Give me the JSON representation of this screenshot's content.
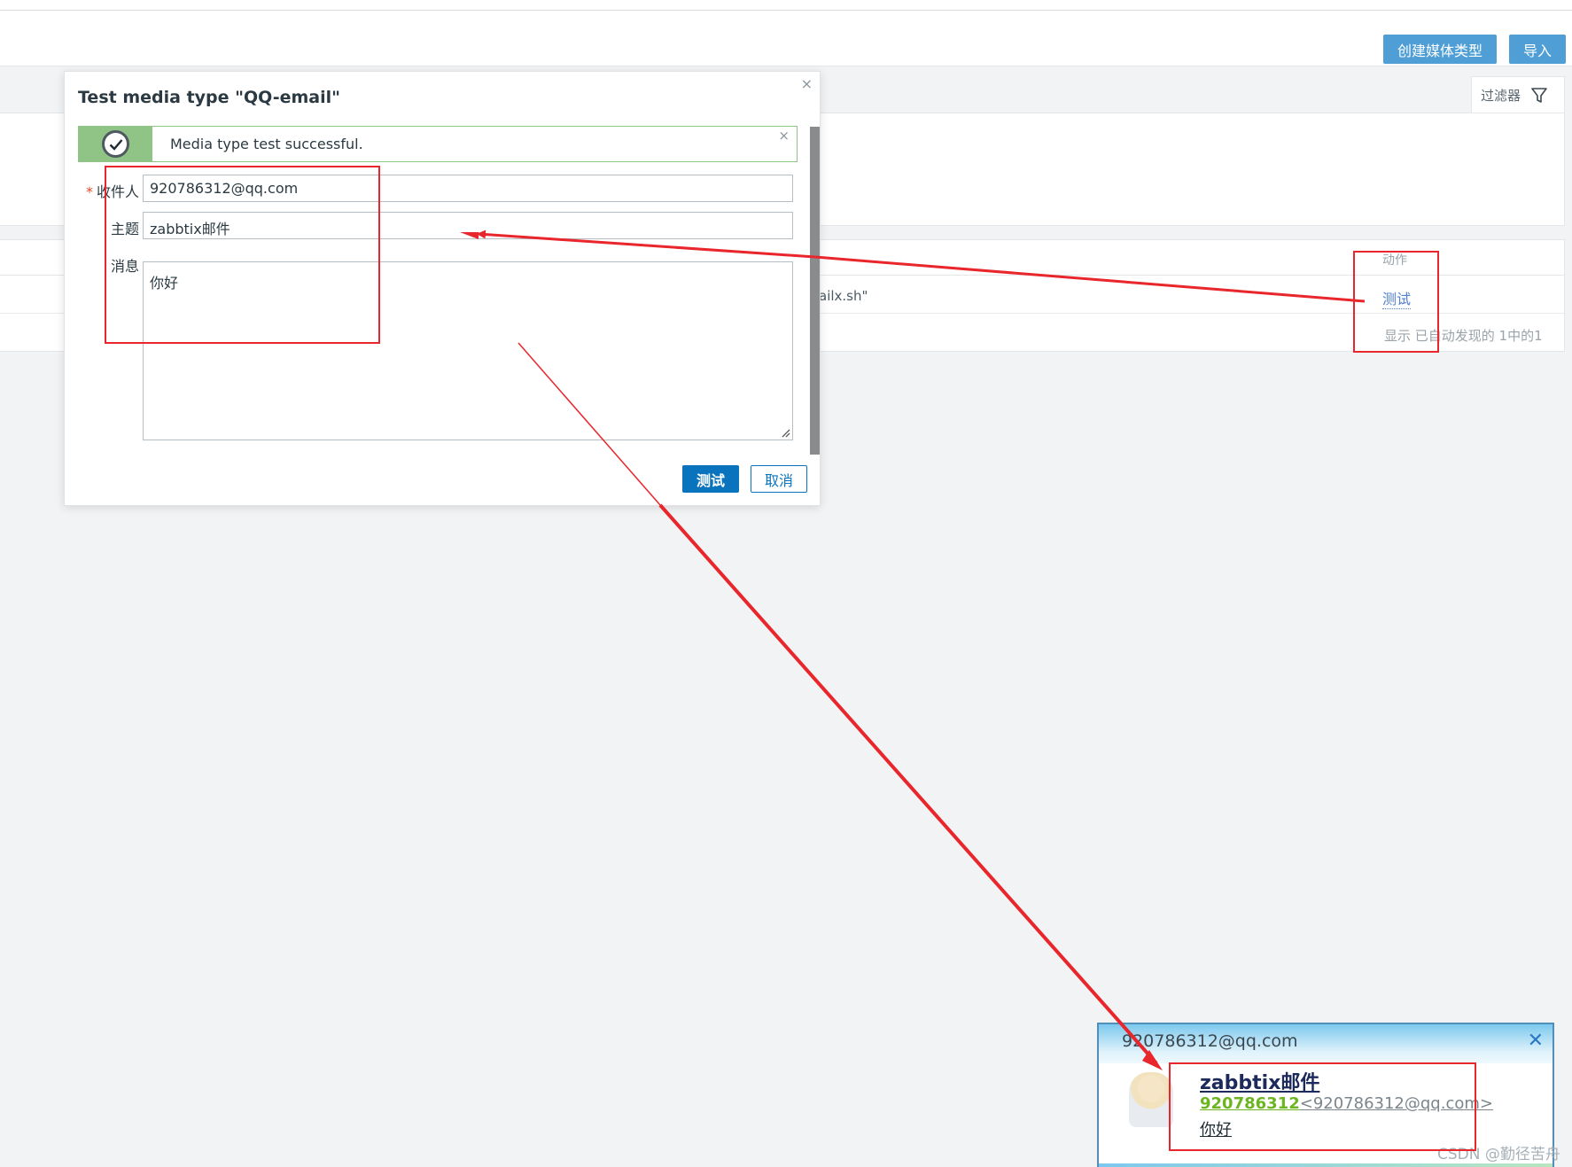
{
  "header": {
    "create_button": "创建媒体类型",
    "import_button": "导入"
  },
  "filter": {
    "label": "过滤器"
  },
  "table": {
    "action_header": "动作",
    "script_fragment": "ailx.sh\"",
    "test_link": "测试",
    "footer": "显示 已自动发现的 1中的1"
  },
  "modal": {
    "title": "Test media type \"QQ-email\"",
    "close": "×",
    "success_message": "Media type test successful.",
    "success_close": "×",
    "fields": {
      "recipient_label": "收件人",
      "recipient_required": "*",
      "recipient_value": "920786312@qq.com",
      "subject_label": "主题",
      "subject_value": "zabbtix邮件",
      "message_label": "消息",
      "message_value": "你好"
    },
    "test_button": "测试",
    "cancel_button": "取消"
  },
  "notification": {
    "from": "920786312@qq.com",
    "close": "✕",
    "subject": "zabbtix邮件",
    "sender_name": "920786312",
    "sender_address": "<920786312@qq.com>",
    "body": "你好"
  },
  "watermark": "CSDN @勤径苦舟",
  "icons": {
    "filter": "funnel-icon",
    "success": "check-circle-icon",
    "resize": "resize-grip-icon",
    "avatar": "user-avatar-icon"
  },
  "colors": {
    "primary": "#0a73bd",
    "header_button": "#4f9ed6",
    "success": "#8fc486",
    "annotation": "#e8262b",
    "link": "#4f7fd1"
  }
}
